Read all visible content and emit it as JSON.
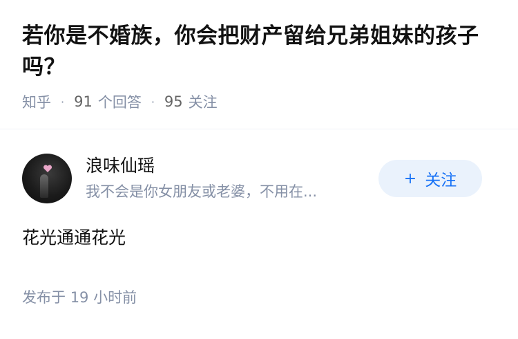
{
  "question": {
    "title": "若你是不婚族，你会把财产留给兄弟姐妹的孩子吗？",
    "source": "知乎",
    "answers_count": "91",
    "answers_label": "个回答",
    "followers_count": "95",
    "followers_label": "关注"
  },
  "answer": {
    "author_name": "浪味仙瑶",
    "author_bio": "我不会是你女朋友或老婆，不用在...",
    "follow_button": {
      "icon": "plus-icon",
      "label": "关注"
    },
    "content": "花光通通花光",
    "publish_label": "发布于",
    "publish_time": "19 小时前"
  },
  "colors": {
    "text": "#121212",
    "meta": "#8590a6",
    "accent": "#1772f6",
    "follow_bg": "#eaf2fc"
  }
}
